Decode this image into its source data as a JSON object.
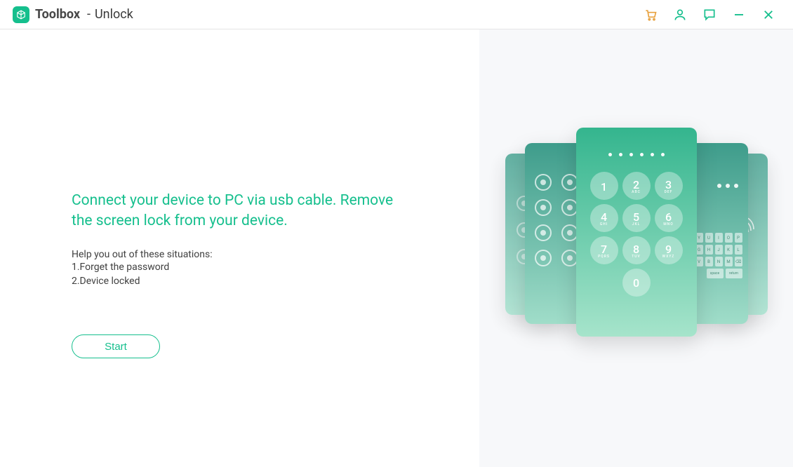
{
  "header": {
    "brand": "Toolbox",
    "page": "Unlock"
  },
  "titlebar_icons": {
    "cart": "cart-icon",
    "user": "user-icon",
    "feedback": "chat-icon",
    "minimize": "minimize-icon",
    "close": "close-icon"
  },
  "content": {
    "headline": "Connect your device to PC via usb cable. Remove the screen lock from your device.",
    "help_label": "Help you out of these situations:",
    "situations": [
      "1.Forget the password",
      "2.Device locked"
    ],
    "start_button": "Start"
  },
  "keypad": [
    {
      "n": "1",
      "l": ""
    },
    {
      "n": "2",
      "l": "ABC"
    },
    {
      "n": "3",
      "l": "DEF"
    },
    {
      "n": "4",
      "l": "GHI"
    },
    {
      "n": "5",
      "l": "JKL"
    },
    {
      "n": "6",
      "l": "MNO"
    },
    {
      "n": "7",
      "l": "PQRS"
    },
    {
      "n": "8",
      "l": "TUV"
    },
    {
      "n": "9",
      "l": "WXYZ"
    }
  ],
  "keypad_zero": "0",
  "kb_row1": [
    "Y",
    "U",
    "I",
    "O",
    "P"
  ],
  "kb_row2": [
    "G",
    "H",
    "J",
    "K",
    "L"
  ],
  "kb_row3": [
    "V",
    "B",
    "N",
    "M"
  ],
  "kb_row4": [
    "space",
    "return"
  ]
}
